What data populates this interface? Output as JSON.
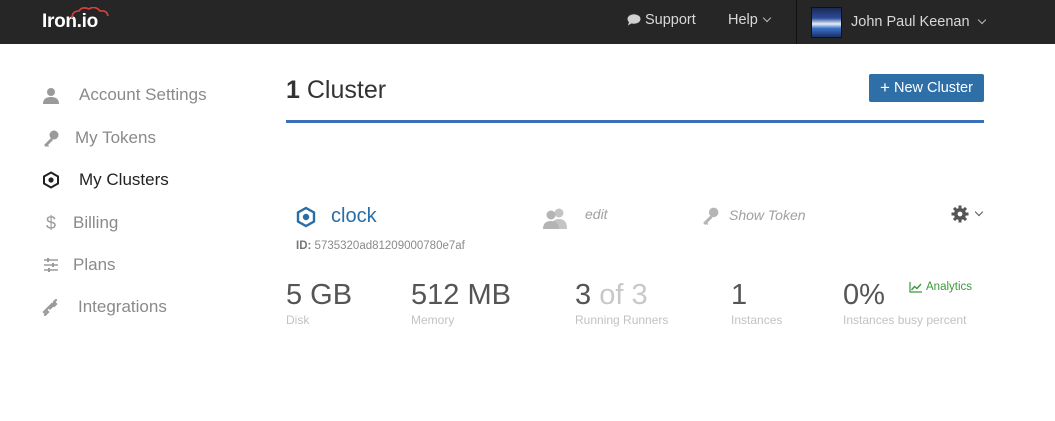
{
  "header": {
    "logo_text": "Iron.io",
    "support_label": "Support",
    "help_label": "Help",
    "user_name": "John Paul Keenan"
  },
  "sidebar": {
    "items": [
      {
        "label": "Account Settings",
        "icon": "user-icon"
      },
      {
        "label": "My Tokens",
        "icon": "key-icon"
      },
      {
        "label": "My Clusters",
        "icon": "hexagon-icon",
        "active": true
      },
      {
        "label": "Billing",
        "icon": "dollar-icon"
      },
      {
        "label": "Plans",
        "icon": "sliders-icon"
      },
      {
        "label": "Integrations",
        "icon": "plug-icon"
      }
    ]
  },
  "main": {
    "title_count": "1",
    "title_text": "Cluster",
    "new_cluster_label": "New Cluster",
    "cluster": {
      "name": "clock",
      "edit_label": "edit",
      "show_token_label": "Show Token",
      "id_label": "ID:",
      "id_value": "5735320ad81209000780e7af",
      "metrics": [
        {
          "value": "5 GB",
          "label": "Disk"
        },
        {
          "value": "512 MB",
          "label": "Memory"
        },
        {
          "value_main": "3",
          "value_muted": "of 3",
          "label": "Running Runners"
        },
        {
          "value": "1",
          "label": "Instances"
        },
        {
          "value": "0%",
          "label": "Instances busy percent"
        }
      ],
      "analytics_label": "Analytics"
    }
  },
  "colors": {
    "topbar": "#262626",
    "accent_blue": "#2e6fa8",
    "rule_blue": "#3b6fb6",
    "analytics_green": "#3a9a3a"
  }
}
